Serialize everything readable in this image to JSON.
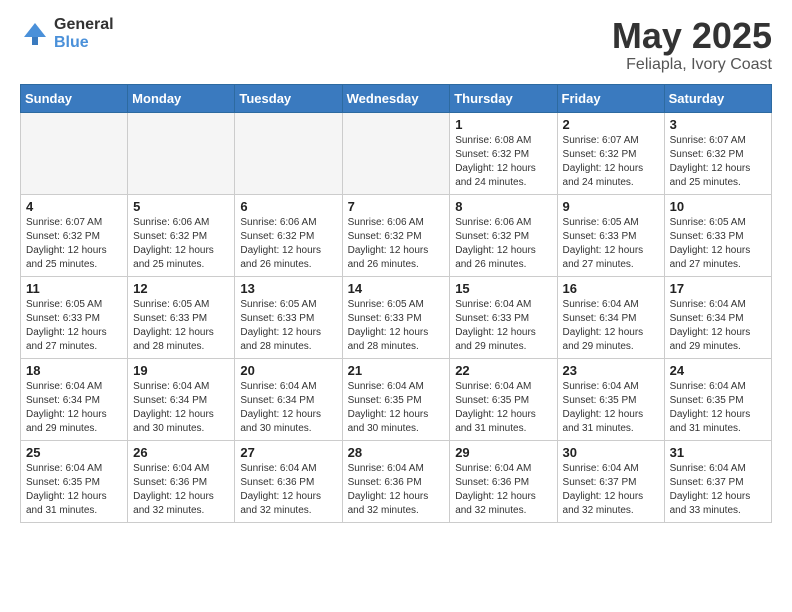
{
  "header": {
    "logo_general": "General",
    "logo_blue": "Blue",
    "month_title": "May 2025",
    "location": "Feliapla, Ivory Coast"
  },
  "weekdays": [
    "Sunday",
    "Monday",
    "Tuesday",
    "Wednesday",
    "Thursday",
    "Friday",
    "Saturday"
  ],
  "weeks": [
    [
      {
        "day": "",
        "info": ""
      },
      {
        "day": "",
        "info": ""
      },
      {
        "day": "",
        "info": ""
      },
      {
        "day": "",
        "info": ""
      },
      {
        "day": "1",
        "info": "Sunrise: 6:08 AM\nSunset: 6:32 PM\nDaylight: 12 hours\nand 24 minutes."
      },
      {
        "day": "2",
        "info": "Sunrise: 6:07 AM\nSunset: 6:32 PM\nDaylight: 12 hours\nand 24 minutes."
      },
      {
        "day": "3",
        "info": "Sunrise: 6:07 AM\nSunset: 6:32 PM\nDaylight: 12 hours\nand 25 minutes."
      }
    ],
    [
      {
        "day": "4",
        "info": "Sunrise: 6:07 AM\nSunset: 6:32 PM\nDaylight: 12 hours\nand 25 minutes."
      },
      {
        "day": "5",
        "info": "Sunrise: 6:06 AM\nSunset: 6:32 PM\nDaylight: 12 hours\nand 25 minutes."
      },
      {
        "day": "6",
        "info": "Sunrise: 6:06 AM\nSunset: 6:32 PM\nDaylight: 12 hours\nand 26 minutes."
      },
      {
        "day": "7",
        "info": "Sunrise: 6:06 AM\nSunset: 6:32 PM\nDaylight: 12 hours\nand 26 minutes."
      },
      {
        "day": "8",
        "info": "Sunrise: 6:06 AM\nSunset: 6:32 PM\nDaylight: 12 hours\nand 26 minutes."
      },
      {
        "day": "9",
        "info": "Sunrise: 6:05 AM\nSunset: 6:33 PM\nDaylight: 12 hours\nand 27 minutes."
      },
      {
        "day": "10",
        "info": "Sunrise: 6:05 AM\nSunset: 6:33 PM\nDaylight: 12 hours\nand 27 minutes."
      }
    ],
    [
      {
        "day": "11",
        "info": "Sunrise: 6:05 AM\nSunset: 6:33 PM\nDaylight: 12 hours\nand 27 minutes."
      },
      {
        "day": "12",
        "info": "Sunrise: 6:05 AM\nSunset: 6:33 PM\nDaylight: 12 hours\nand 28 minutes."
      },
      {
        "day": "13",
        "info": "Sunrise: 6:05 AM\nSunset: 6:33 PM\nDaylight: 12 hours\nand 28 minutes."
      },
      {
        "day": "14",
        "info": "Sunrise: 6:05 AM\nSunset: 6:33 PM\nDaylight: 12 hours\nand 28 minutes."
      },
      {
        "day": "15",
        "info": "Sunrise: 6:04 AM\nSunset: 6:33 PM\nDaylight: 12 hours\nand 29 minutes."
      },
      {
        "day": "16",
        "info": "Sunrise: 6:04 AM\nSunset: 6:34 PM\nDaylight: 12 hours\nand 29 minutes."
      },
      {
        "day": "17",
        "info": "Sunrise: 6:04 AM\nSunset: 6:34 PM\nDaylight: 12 hours\nand 29 minutes."
      }
    ],
    [
      {
        "day": "18",
        "info": "Sunrise: 6:04 AM\nSunset: 6:34 PM\nDaylight: 12 hours\nand 29 minutes."
      },
      {
        "day": "19",
        "info": "Sunrise: 6:04 AM\nSunset: 6:34 PM\nDaylight: 12 hours\nand 30 minutes."
      },
      {
        "day": "20",
        "info": "Sunrise: 6:04 AM\nSunset: 6:34 PM\nDaylight: 12 hours\nand 30 minutes."
      },
      {
        "day": "21",
        "info": "Sunrise: 6:04 AM\nSunset: 6:35 PM\nDaylight: 12 hours\nand 30 minutes."
      },
      {
        "day": "22",
        "info": "Sunrise: 6:04 AM\nSunset: 6:35 PM\nDaylight: 12 hours\nand 31 minutes."
      },
      {
        "day": "23",
        "info": "Sunrise: 6:04 AM\nSunset: 6:35 PM\nDaylight: 12 hours\nand 31 minutes."
      },
      {
        "day": "24",
        "info": "Sunrise: 6:04 AM\nSunset: 6:35 PM\nDaylight: 12 hours\nand 31 minutes."
      }
    ],
    [
      {
        "day": "25",
        "info": "Sunrise: 6:04 AM\nSunset: 6:35 PM\nDaylight: 12 hours\nand 31 minutes."
      },
      {
        "day": "26",
        "info": "Sunrise: 6:04 AM\nSunset: 6:36 PM\nDaylight: 12 hours\nand 32 minutes."
      },
      {
        "day": "27",
        "info": "Sunrise: 6:04 AM\nSunset: 6:36 PM\nDaylight: 12 hours\nand 32 minutes."
      },
      {
        "day": "28",
        "info": "Sunrise: 6:04 AM\nSunset: 6:36 PM\nDaylight: 12 hours\nand 32 minutes."
      },
      {
        "day": "29",
        "info": "Sunrise: 6:04 AM\nSunset: 6:36 PM\nDaylight: 12 hours\nand 32 minutes."
      },
      {
        "day": "30",
        "info": "Sunrise: 6:04 AM\nSunset: 6:37 PM\nDaylight: 12 hours\nand 32 minutes."
      },
      {
        "day": "31",
        "info": "Sunrise: 6:04 AM\nSunset: 6:37 PM\nDaylight: 12 hours\nand 33 minutes."
      }
    ]
  ]
}
